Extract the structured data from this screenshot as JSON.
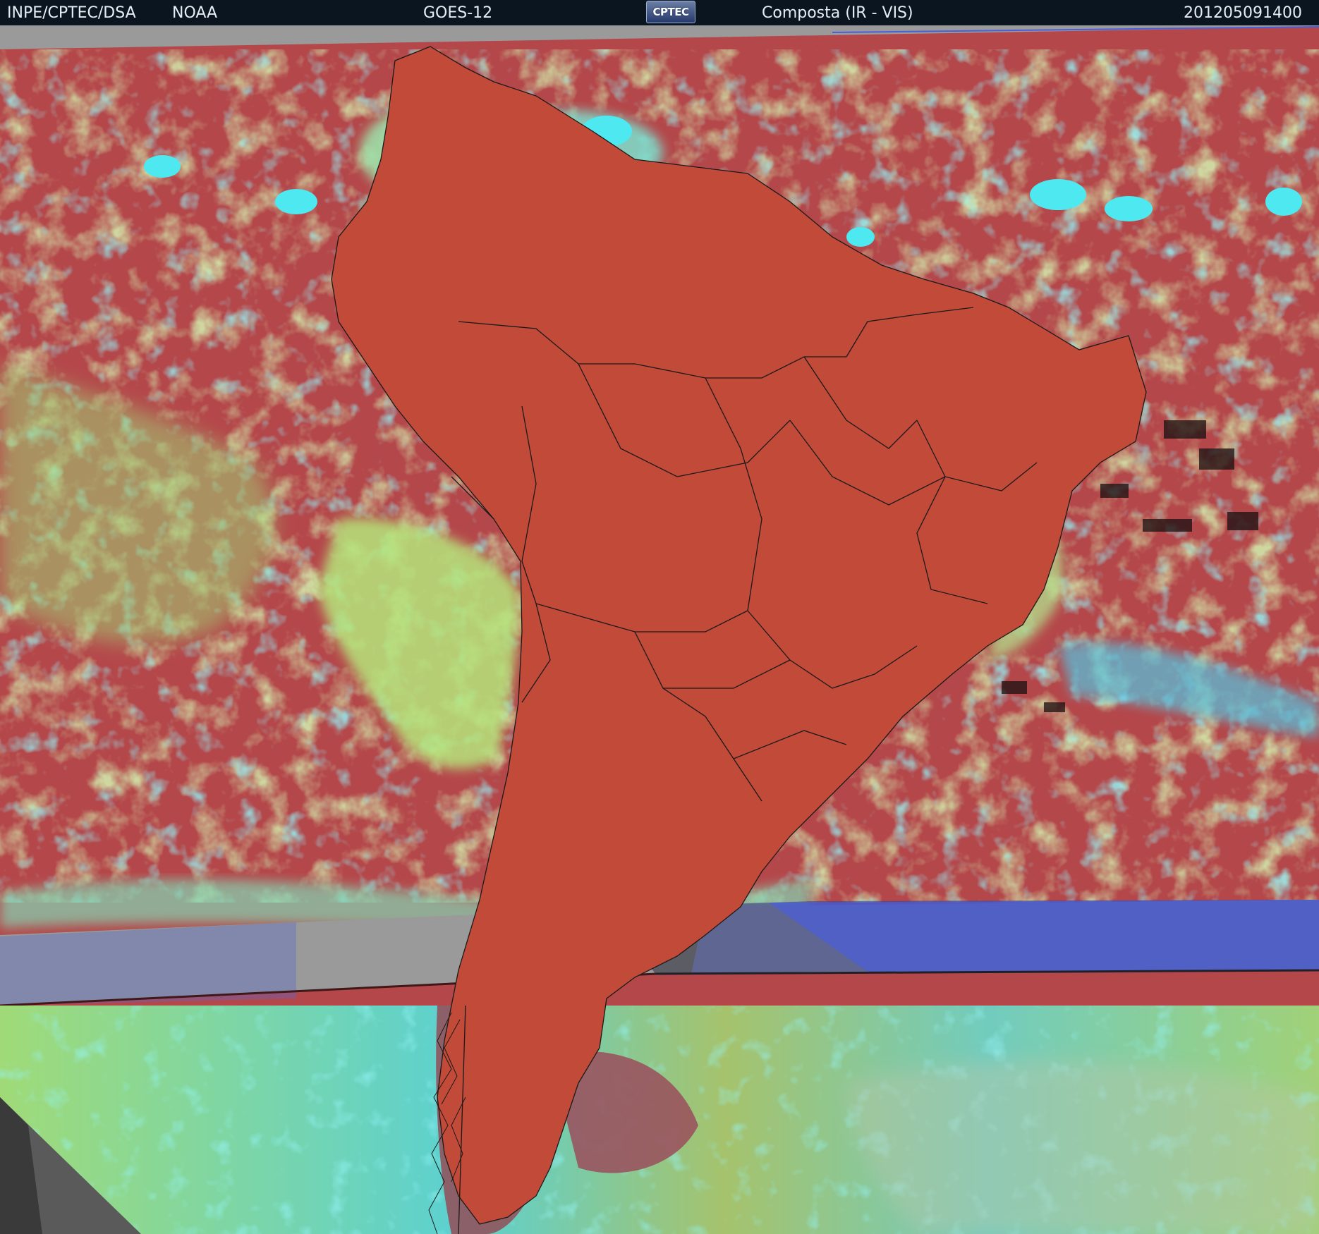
{
  "header": {
    "organization": "INPE/CPTEC/DSA",
    "agency": "NOAA",
    "satellite": "GOES-12",
    "logo_text": "CPTEC",
    "product": "Composta (IR - VIS)",
    "timestamp": "201205091400"
  },
  "imagery": {
    "description_icon": "satellite-composite-image",
    "colors": {
      "land_clear": "#c24a38",
      "ocean_clear": "#b4474a",
      "low_cloud": "#a8e070",
      "high_cloud": "#4ee8f0",
      "cold_cloud": "#5fa8e0",
      "no_data": "#9a9a9a",
      "ir_band": "#4a5edc"
    }
  }
}
